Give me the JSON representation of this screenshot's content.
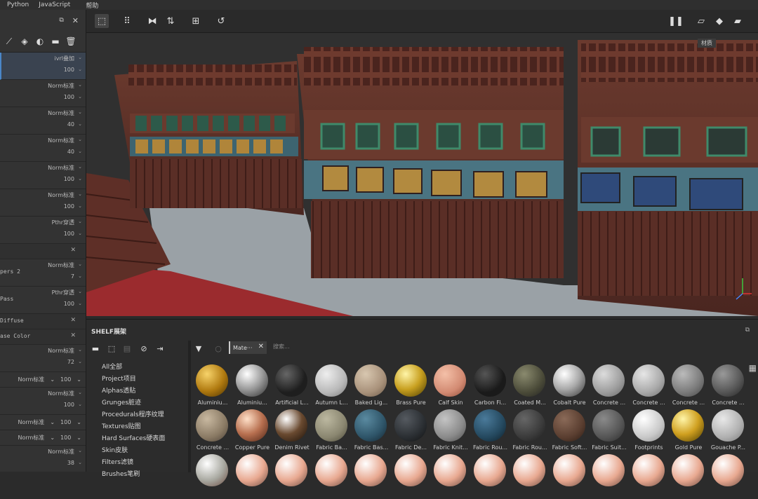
{
  "menubar": {
    "items": [
      "Python",
      "JavaScript",
      "帮助"
    ]
  },
  "layers": {
    "rows": [
      {
        "mode": "ivrl叠加",
        "opacity": "100",
        "selected": true
      },
      {
        "mode": "Norm标准",
        "opacity": "100"
      },
      {
        "mode": "Norm标准",
        "opacity": "40"
      },
      {
        "mode": "Norm标准",
        "opacity": "40"
      },
      {
        "mode": "Norm标准",
        "opacity": "100"
      },
      {
        "mode": "Norm标准",
        "opacity": "100"
      },
      {
        "mode": "Pthr穿透",
        "opacity": "100"
      }
    ],
    "empty_slot": "",
    "papers": {
      "name": "pers 2",
      "mode": "Norm标准",
      "opacity": "7"
    },
    "pass": {
      "name": "Pass",
      "mode": "Pthr穿透",
      "opacity": "100"
    },
    "diffuse": "Diffuse",
    "base_color": "ase Color",
    "bottom_rows": [
      {
        "mode": "Norm标准",
        "opacity": "72"
      },
      {
        "pair": [
          "Norm标准",
          "100"
        ]
      },
      {
        "mode": "Norm标准",
        "opacity": "100"
      },
      {
        "pair": [
          "Norm标准",
          "100"
        ]
      },
      {
        "pair": [
          "Norm标准",
          "100"
        ]
      },
      {
        "mode": "Norm标准",
        "opacity": "38"
      }
    ]
  },
  "viewport": {
    "label": "材质"
  },
  "shelf": {
    "title": "SHELF展架",
    "filter_tag": "Mate···",
    "search_placeholder": "搜索...",
    "categories": [
      "All全部",
      "Project项目",
      "Alphas透贴",
      "Grunges脏迹",
      "Procedurals程序纹理",
      "Textures贴图",
      "Hard Surfaces硬表面",
      "Skin皮肤",
      "Filters滤镜",
      "Brushes笔刷"
    ],
    "materials_row1": [
      "Aluminiu...",
      "Aluminiu...",
      "Artificial L...",
      "Autumn L...",
      "Baked Lig...",
      "Brass Pure",
      "Calf Skin",
      "Carbon Fi...",
      "Coated M...",
      "Cobalt Pure",
      "Concrete ...",
      "Concrete ...",
      "Concrete ...",
      "Concrete ..."
    ],
    "materials_row2": [
      "Concrete ...",
      "Copper Pure",
      "Denim Rivet",
      "Fabric Ba...",
      "Fabric Bas...",
      "Fabric De...",
      "Fabric Knit...",
      "Fabric Rou...",
      "Fabric Rou...",
      "Fabric Soft...",
      "Fabric Suit...",
      "Footprints",
      "Gold Pure",
      "Gouache P..."
    ]
  },
  "colors": {
    "accent": "#4a86c8",
    "viewport_bg": "#303030"
  }
}
